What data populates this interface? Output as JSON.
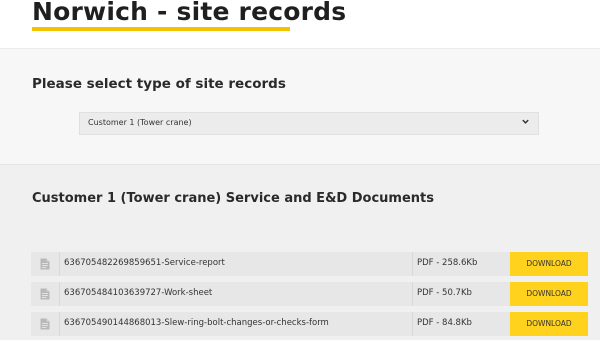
{
  "header": {
    "title": "Norwich - site records"
  },
  "selector": {
    "heading": "Please select type of site records",
    "selected": "Customer 1 (Tower crane)"
  },
  "documents": {
    "heading": "Customer 1 (Tower crane) Service and E&D Documents",
    "items": [
      {
        "name": "636705482269859651-Service-report",
        "meta": "PDF - 258.6Kb",
        "action": "DOWNLOAD",
        "icon": "document-icon"
      },
      {
        "name": "636705484103639727-Work-sheet",
        "meta": "PDF - 50.7Kb",
        "action": "DOWNLOAD",
        "icon": "document-icon"
      },
      {
        "name": "636705490144868013-Slew-ring-bolt-changes-or-checks-form",
        "meta": "PDF - 84.8Kb",
        "action": "DOWNLOAD",
        "icon": "document-icon"
      }
    ]
  },
  "colors": {
    "accent": "#f2c400",
    "button": "#ffd21e"
  }
}
